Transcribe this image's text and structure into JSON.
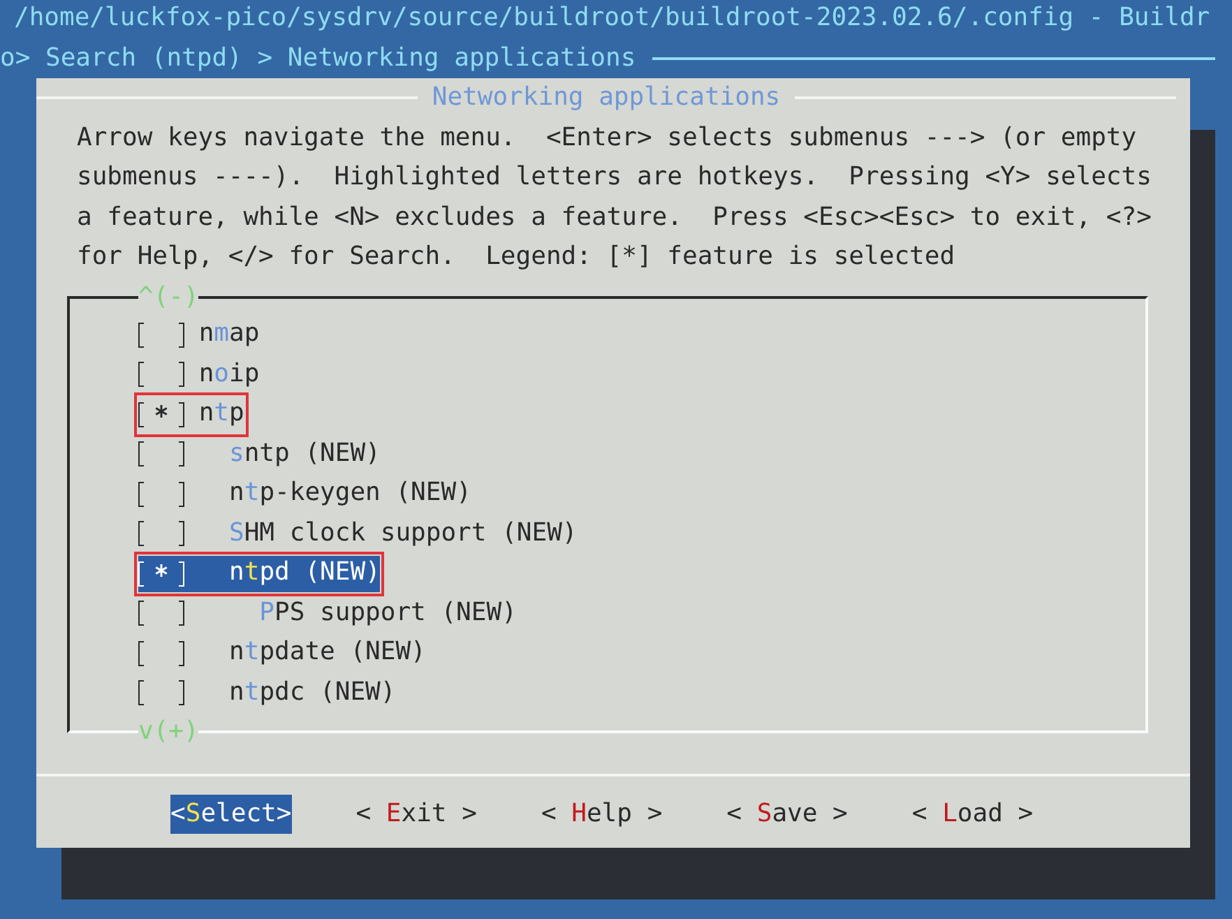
{
  "window": {
    "title": "/home/luckfox-pico/sysdrv/source/buildroot/buildroot-2023.02.6/.config - Buildr"
  },
  "breadcrumb": "o> Search (ntpd) > Networking applications",
  "dialog": {
    "title": "Networking applications",
    "help": "Arrow keys navigate the menu.  <Enter> selects submenus ---> (or empty submenus ----).  Highlighted letters are hotkeys.  Pressing <Y> selects a feature, while <N> excludes a feature.  Press <Esc><Esc> to exit, <?> for Help, </> for Search.  Legend: [*] feature is selected",
    "scroll_up": "^(-)",
    "scroll_down": "v(+)",
    "items": [
      {
        "checked": false,
        "selected": false,
        "annotated": false,
        "label": {
          "before": "n",
          "hotkey": "m",
          "after": "ap"
        }
      },
      {
        "checked": false,
        "selected": false,
        "annotated": false,
        "label": {
          "before": "n",
          "hotkey": "o",
          "after": "ip"
        }
      },
      {
        "checked": true,
        "selected": false,
        "annotated": true,
        "label": {
          "before": "n",
          "hotkey": "t",
          "after": "p"
        },
        "children": [
          {
            "checked": false,
            "selected": false,
            "annotated": false,
            "label": {
              "hotkey": "s",
              "after": "ntp (NEW)"
            }
          },
          {
            "checked": false,
            "selected": false,
            "annotated": false,
            "label": {
              "before": "n",
              "hotkey": "t",
              "after": "p-keygen (NEW)"
            }
          },
          {
            "checked": false,
            "selected": false,
            "annotated": false,
            "label": {
              "hotkey": "S",
              "after": "HM clock support (NEW)"
            }
          },
          {
            "checked": true,
            "selected": true,
            "annotated": true,
            "label": {
              "before": "n",
              "hotkey": "t",
              "after": "pd (NEW)"
            },
            "children": [
              {
                "checked": false,
                "selected": false,
                "annotated": false,
                "label": {
                  "hotkey": "P",
                  "after": "PS support (NEW)"
                }
              }
            ]
          },
          {
            "checked": false,
            "selected": false,
            "annotated": false,
            "label": {
              "before": "n",
              "hotkey": "t",
              "after": "pdate (NEW)"
            }
          },
          {
            "checked": false,
            "selected": false,
            "annotated": false,
            "label": {
              "before": "n",
              "hotkey": "t",
              "after": "pdc (NEW)"
            }
          }
        ]
      }
    ],
    "buttons": [
      {
        "selected": true,
        "before": "<",
        "hotkey": "S",
        "after": "elect>"
      },
      {
        "selected": false,
        "before": "< ",
        "hotkey": "E",
        "after": "xit >"
      },
      {
        "selected": false,
        "before": "< ",
        "hotkey": "H",
        "after": "elp >"
      },
      {
        "selected": false,
        "before": "< ",
        "hotkey": "S",
        "after": "ave >"
      },
      {
        "selected": false,
        "before": "< ",
        "hotkey": "L",
        "after": "oad >"
      }
    ]
  }
}
